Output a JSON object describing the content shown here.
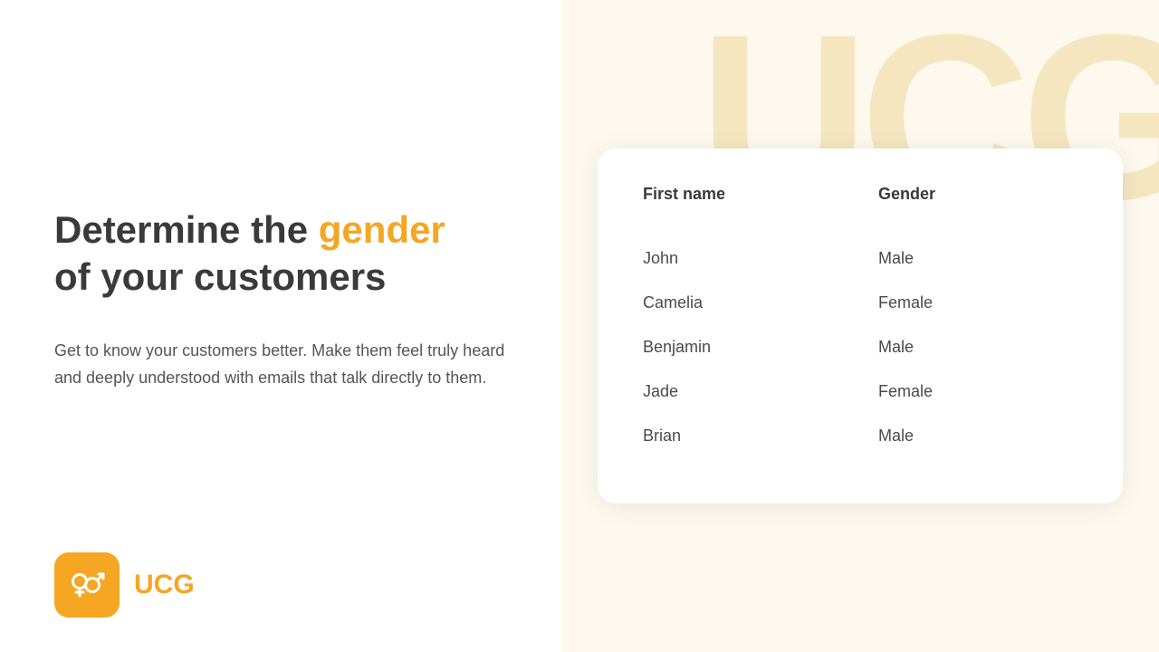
{
  "left": {
    "headline_part1": "Determine the ",
    "headline_accent": "gender",
    "headline_part2": "of your customers",
    "description": "Get to know your customers better. Make them feel truly heard and deeply understood with emails that talk directly to them.",
    "logo_text": "UCG"
  },
  "right": {
    "watermark": "UCG",
    "table": {
      "col_name": "First name",
      "col_gender": "Gender",
      "rows": [
        {
          "name": "John",
          "gender": "Male"
        },
        {
          "name": "Camelia",
          "gender": "Female"
        },
        {
          "name": "Benjamin",
          "gender": "Male"
        },
        {
          "name": "Jade",
          "gender": "Female"
        },
        {
          "name": "Brian",
          "gender": "Male"
        }
      ]
    }
  },
  "colors": {
    "accent": "#f5a623",
    "text_dark": "#3a3a3a",
    "text_mid": "#555555",
    "bg_right": "#fef9ee",
    "watermark": "#f5e6c0"
  }
}
